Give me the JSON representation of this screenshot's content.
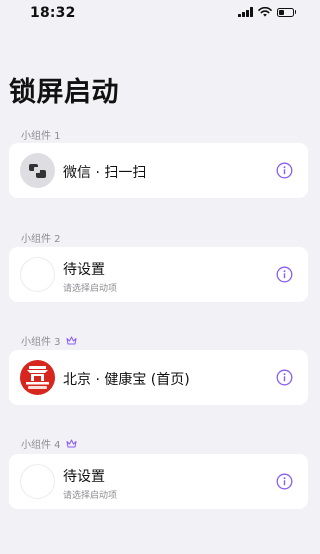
{
  "status_bar": {
    "time": "18:32"
  },
  "page": {
    "title": "锁屏启动"
  },
  "widgets": [
    {
      "label": "小组件 1",
      "title": "微信 · 扫一扫",
      "subtitle": "",
      "icon": "wechat-scan-icon",
      "premium": false
    },
    {
      "label": "小组件 2",
      "title": "待设置",
      "subtitle": "请选择启动项",
      "icon": "empty-icon",
      "premium": false
    },
    {
      "label": "小组件 3",
      "title": "北京 · 健康宝 (首页)",
      "subtitle": "",
      "icon": "beijing-health-kit-icon",
      "premium": true
    },
    {
      "label": "小组件 4",
      "title": "待设置",
      "subtitle": "请选择启动项",
      "icon": "empty-icon",
      "premium": true
    }
  ],
  "colors": {
    "accent": "#8a5cf6",
    "background": "#f2f2f6",
    "card": "#ffffff",
    "health_red": "#d6261d"
  }
}
